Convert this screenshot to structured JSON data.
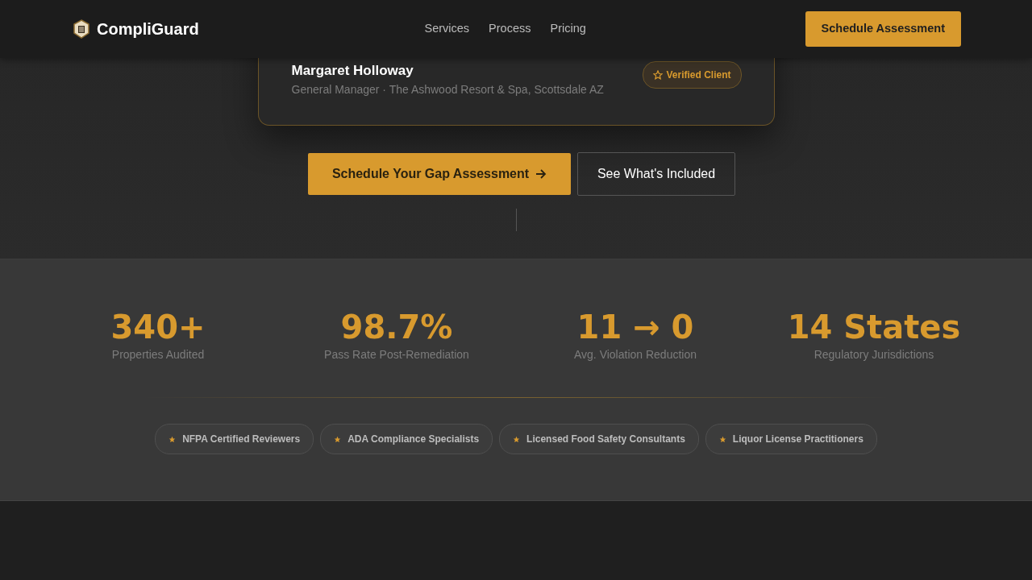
{
  "brand": {
    "name": "CompliGuard"
  },
  "nav": {
    "links": [
      "Services",
      "Process",
      "Pricing"
    ],
    "cta": "Schedule Assessment"
  },
  "testimonial": {
    "name": "Margaret Holloway",
    "role": "General Manager · The Ashwood Resort & Spa, Scottsdale AZ",
    "badge": "Verified Client"
  },
  "hero_buttons": [
    {
      "label": "Schedule Your Gap Assessment",
      "kind": "primary"
    },
    {
      "label": "See What's Included",
      "kind": "outline"
    }
  ],
  "stats": [
    {
      "value": "340+",
      "label": "Properties Audited"
    },
    {
      "value": "98.7%",
      "label": "Pass Rate Post-Remediation"
    },
    {
      "value": "11 → 0",
      "label": "Avg. Violation Reduction"
    },
    {
      "value": "14 States",
      "label": "Regulatory Jurisdictions"
    }
  ],
  "credentials": [
    "NFPA Certified Reviewers",
    "ADA Compliance Specialists",
    "Licensed Food Safety Consultants",
    "Liquor License Practitioners"
  ]
}
